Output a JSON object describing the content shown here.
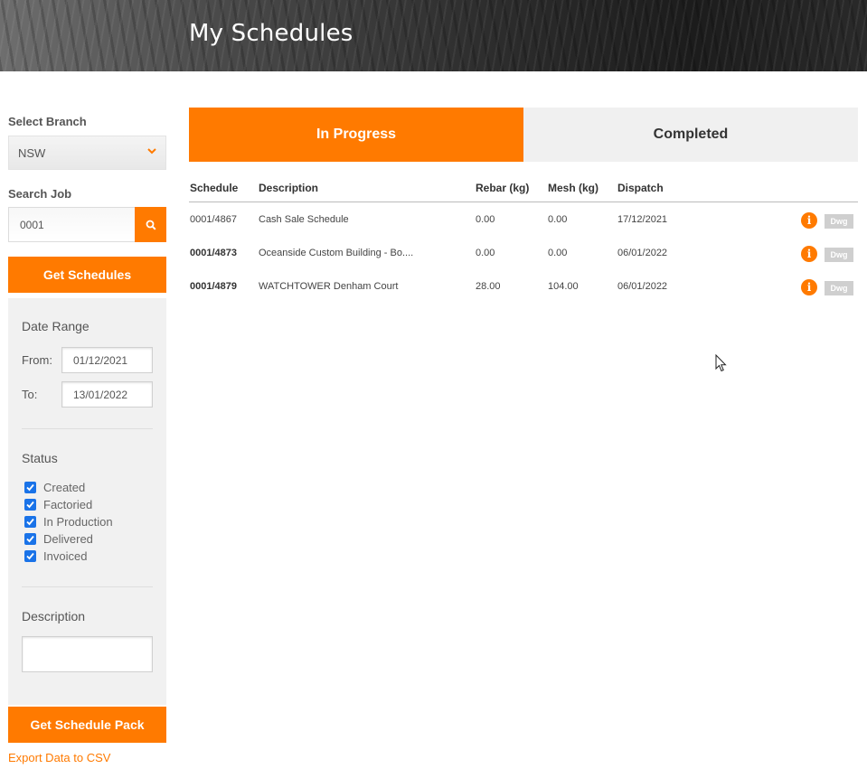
{
  "header": {
    "title": "My Schedules"
  },
  "sidebar": {
    "branch_label": "Select Branch",
    "branch_value": "NSW",
    "search_label": "Search Job",
    "search_value": "0001",
    "get_schedules_label": "Get Schedules",
    "date_range": {
      "title": "Date Range",
      "from_label": "From:",
      "from_value": "01/12/2021",
      "to_label": "To:",
      "to_value": "13/01/2022"
    },
    "status": {
      "title": "Status",
      "items": [
        {
          "label": "Created",
          "checked": true
        },
        {
          "label": "Factoried",
          "checked": true
        },
        {
          "label": "In Production",
          "checked": true
        },
        {
          "label": "Delivered",
          "checked": true
        },
        {
          "label": "Invoiced",
          "checked": true
        }
      ]
    },
    "description_label": "Description",
    "description_value": "",
    "get_pack_label": "Get Schedule Pack",
    "export_label": "Export Data to CSV"
  },
  "tabs": [
    {
      "label": "In Progress",
      "active": true
    },
    {
      "label": "Completed",
      "active": false
    }
  ],
  "table": {
    "columns": [
      "Schedule",
      "Description",
      "Rebar (kg)",
      "Mesh (kg)",
      "Dispatch"
    ],
    "rows": [
      {
        "schedule": "0001/4867",
        "description": "Cash Sale Schedule",
        "rebar": "0.00",
        "mesh": "0.00",
        "dispatch": "17/12/2021",
        "bold": false,
        "dwg": "Dwg",
        "info_icon": "info-icon"
      },
      {
        "schedule": "0001/4873",
        "description": "Oceanside Custom Building - Bo....",
        "rebar": "0.00",
        "mesh": "0.00",
        "dispatch": "06/01/2022",
        "bold": true,
        "dwg": "Dwg",
        "info_icon": "info-icon"
      },
      {
        "schedule": "0001/4879",
        "description": "WATCHTOWER Denham Court",
        "rebar": "28.00",
        "mesh": "104.00",
        "dispatch": "06/01/2022",
        "bold": true,
        "dwg": "Dwg",
        "info_icon": "info-icon"
      }
    ]
  },
  "colors": {
    "accent": "#ff7a00",
    "checkbox": "#1a73e8",
    "tab_inactive": "#f0f0f0",
    "panel": "#f1f1f1"
  }
}
